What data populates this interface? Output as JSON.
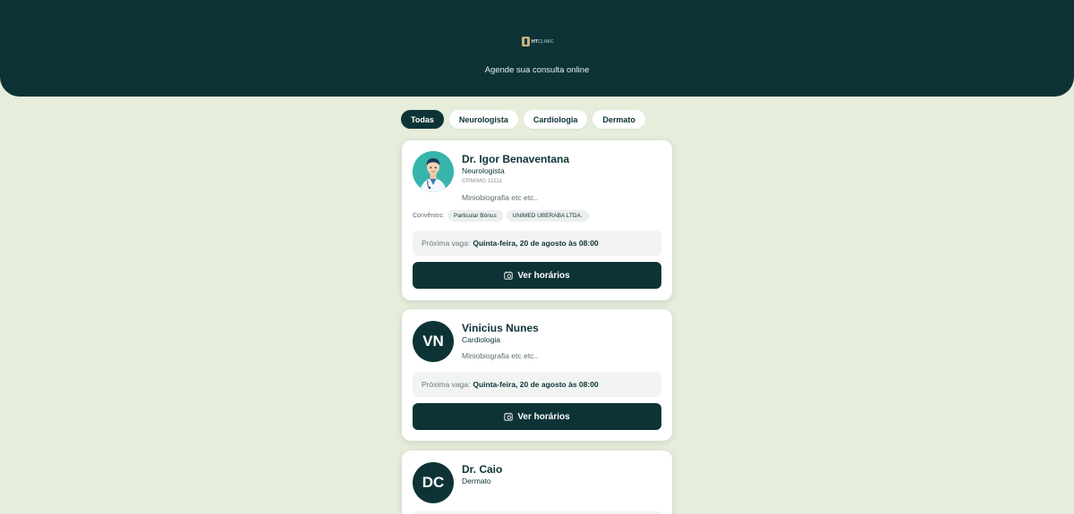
{
  "header": {
    "logo_bold": "HT",
    "logo_thin": "CLINIC",
    "subtitle": "Agende sua consulta online",
    "bg_color": "#0d3336"
  },
  "filters": [
    "Todas",
    "Neurologista",
    "Cardiologia",
    "Dermato"
  ],
  "active_filter": "Todas",
  "doctors": [
    {
      "initials": "",
      "avatar": "doctor-photo-icon",
      "name": "Dr. Igor Benaventana",
      "specialty": "Neurologista",
      "crm": "CRM/MG 11111",
      "bio": "Miniobiografia etc etc..",
      "convenios_label": "Convênios:",
      "convenios": [
        "Particular Bônus",
        "UNIMED UBERABA LTDA."
      ],
      "next_label": "Próxima vaga:",
      "next_value": "Quinta-feira, 20 de agosto às 08:00",
      "button": "Ver horários"
    },
    {
      "initials": "VN",
      "name": "Vinicius Nunes",
      "specialty": "Cardiologia",
      "bio": "Miniobiografia etc etc..",
      "next_label": "Próxima vaga:",
      "next_value": "Quinta-feira, 20 de agosto às 08:00",
      "button": "Ver horários"
    },
    {
      "initials": "DC",
      "name": "Dr. Caio",
      "specialty": "Dermato"
    }
  ]
}
